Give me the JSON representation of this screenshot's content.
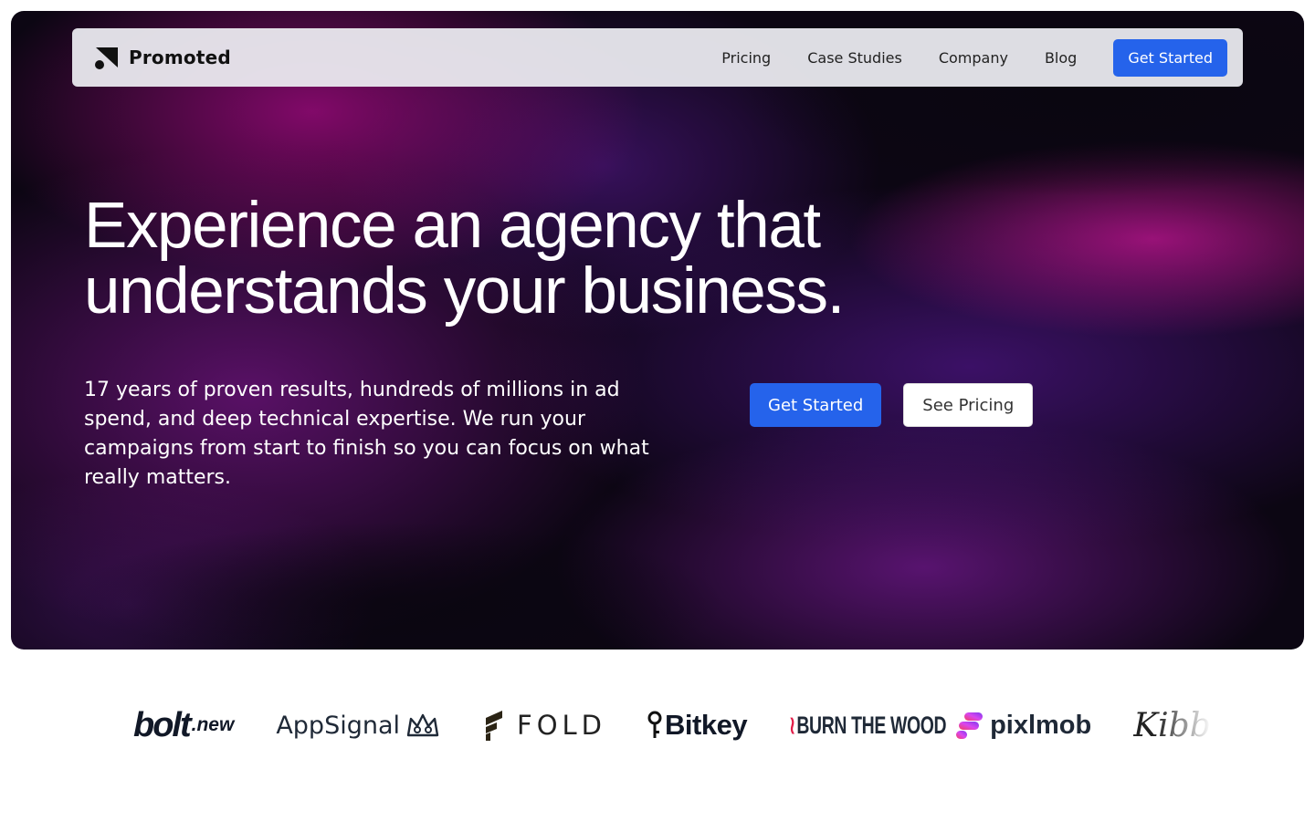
{
  "navbar": {
    "brand": "Promoted",
    "links": [
      "Pricing",
      "Case Studies",
      "Company",
      "Blog"
    ],
    "cta_label": "Get Started"
  },
  "hero": {
    "headline_line1": "Experience an agency that",
    "headline_line2": "understands your business.",
    "subcopy": "17 years of proven results, hundreds of millions in ad spend, and deep technical expertise. We run your campaigns from start to finish so you can focus on what really matters.",
    "primary_cta": "Get Started",
    "secondary_cta": "See Pricing"
  },
  "client_logos": {
    "bolt": {
      "name": "bolt",
      "suffix": ".new"
    },
    "appsignal": "AppSignal",
    "fold": "FOLD",
    "bitkey": "Bitkey",
    "burnthewood": "BURN THE WOOD",
    "pixlmob": "pixlmob",
    "kibb": "Kibb"
  },
  "colors": {
    "primary": "#2563eb",
    "hero_background": "#0c0613",
    "hero_magenta": "#b9148c",
    "hero_purple": "#4b1482"
  },
  "icons": {
    "brand": "promoted-logo-icon",
    "appsignal": "crown-icon",
    "fold": "fold-leaf-icon",
    "bitkey": "key-icon",
    "pixlmob": "pixlmob-icon"
  }
}
